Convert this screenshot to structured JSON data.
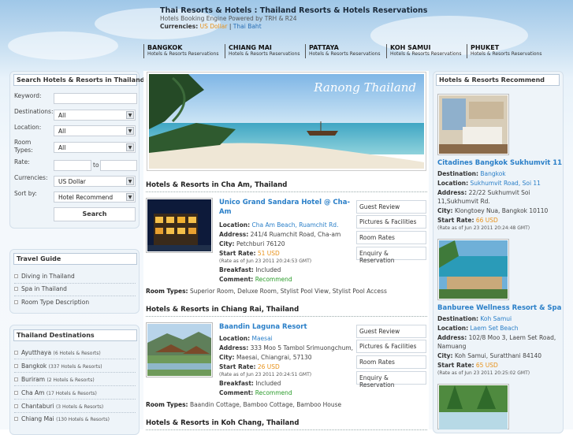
{
  "header": {
    "title": "Thai Resorts & Hotels : Thailand Resorts & Hotels Reservations",
    "subtitle": "Hotels Booking Engine Powered by TRH & R24",
    "currencies_label": "Currencies:",
    "currency_usd": "US Dollar",
    "separator": "|",
    "currency_thb": "Thai Baht"
  },
  "nav": [
    {
      "city": "BANGKOK",
      "sub": "Hotels & Resorts Reservations"
    },
    {
      "city": "CHIANG MAI",
      "sub": "Hotels & Resorts Reservations"
    },
    {
      "city": "PATTAYA",
      "sub": "Hotels & Resorts Reservations"
    },
    {
      "city": "KOH SAMUI",
      "sub": "Hotels & Resorts Reservations"
    },
    {
      "city": "PHUKET",
      "sub": "Hotels & Resorts Reservations"
    }
  ],
  "search": {
    "title": "Search Hotels & Resorts in Thailand",
    "keyword_label": "Keyword:",
    "destinations_label": "Destinations:",
    "destinations_value": "All",
    "location_label": "Location:",
    "location_value": "All",
    "roomtypes_label": "Room Types:",
    "roomtypes_value": "All",
    "rate_label": "Rate:",
    "rate_to": "to",
    "currencies_label": "Currencies:",
    "currencies_value": "US Dollar",
    "sortby_label": "Sort by:",
    "sortby_value": "Hotel Recommend",
    "button": "Search"
  },
  "travel_guide": {
    "title": "Travel Guide",
    "items": [
      "Diving in Thailand",
      "Spa in Thailand",
      "Room Type Description"
    ]
  },
  "destinations": {
    "title": "Thailand Destinations",
    "items": [
      {
        "name": "Ayutthaya",
        "count": "(6 Hotels & Resorts)"
      },
      {
        "name": "Bangkok",
        "count": "(337 Hotels & Resorts)"
      },
      {
        "name": "Buriram",
        "count": "(2 Hotels & Resorts)"
      },
      {
        "name": "Cha Am",
        "count": "(17 Hotels & Resorts)"
      },
      {
        "name": "Chantaburi",
        "count": "(3 Hotels & Resorts)"
      },
      {
        "name": "Chiang Mai",
        "count": "(130 Hotels & Resorts)"
      }
    ]
  },
  "banner": {
    "caption": "Ranong Thailand"
  },
  "sections": [
    {
      "heading": "Hotels & Resorts in Cha Am, Thailand",
      "hotel": {
        "name": "Unico Grand Sandara Hotel @ Cha-Am",
        "location_label": "Location:",
        "location": "Cha Am Beach, Ruamchit Rd.",
        "address_label": "Address:",
        "address": "241/4 Ruamchit Road, Cha-am",
        "city_label": "City:",
        "city": "Petchburi 76120",
        "rate_label": "Start Rate:",
        "rate": "51 USD",
        "rate_note": "(Rate as of Jun 23 2011 20:24:53 GMT)",
        "breakfast_label": "Breakfast:",
        "breakfast": "Included",
        "comment_label": "Comment:",
        "comment": "Recommend",
        "roomtypes_label": "Room Types:",
        "roomtypes": "Superior Room, Deluxe Room, Stylist Pool View, Stylist Pool Access"
      }
    },
    {
      "heading": "Hotels & Resorts in Chiang Rai, Thailand",
      "hotel": {
        "name": "Baandin Laguna Resort",
        "location_label": "Location:",
        "location": "Maesai",
        "address_label": "Address:",
        "address": "333 Moo 5 Tambol Srimuongchum,",
        "city_label": "City:",
        "city": "Maesai, Chiangrai, 57130",
        "rate_label": "Start Rate:",
        "rate": "26 USD",
        "rate_note": "(Rate as of Jun 23 2011 20:24:51 GMT)",
        "breakfast_label": "Breakfast:",
        "breakfast": "Included",
        "comment_label": "Comment:",
        "comment": "Recommend",
        "roomtypes_label": "Room Types:",
        "roomtypes": "Baandin Cottage, Bamboo Cottage, Bamboo House"
      }
    },
    {
      "heading": "Hotels & Resorts in Koh Chang, Thailand"
    }
  ],
  "action_buttons": [
    "Guest Review",
    "Pictures & Facilities",
    "Room Rates",
    "Enquiry & Reservation"
  ],
  "recommend": {
    "title": "Hotels & Resorts Recommend",
    "items": [
      {
        "name": "Citadines Bangkok Sukhumvit 11",
        "destination_label": "Destination:",
        "destination": "Bangkok",
        "location_label": "Location:",
        "location": "Sukhumvit Road, Soi 11",
        "address_label": "Address:",
        "address_1": "22/22 Sukhumvit Soi",
        "address_2": "11,Sukhumvit Rd.",
        "city_label": "City:",
        "city": "Klongtoey Nua, Bangkok 10110",
        "rate_label": "Start Rate:",
        "rate": "66 USD",
        "rate_note": "(Rate as of Jun 23 2011 20:24:48 GMT)"
      },
      {
        "name": "Banburee Wellness Resort & Spa",
        "destination_label": "Destination:",
        "destination": "Koh Samui",
        "location_label": "Location:",
        "location": "Laem Set Beach",
        "address_label": "Address:",
        "address_1": "102/8 Moo 3, Laem Set Road,",
        "address_2": "Namuang",
        "city_label": "City:",
        "city": "Koh Samui, Suratthani 84140",
        "rate_label": "Start Rate:",
        "rate": "65 USD",
        "rate_note": "(Rate as of Jun 23 2011 20:25:02 GMT)"
      }
    ]
  },
  "colors": {
    "link": "#2a7fc8",
    "rate": "#e8921a",
    "comment": "#2a9b2a"
  }
}
